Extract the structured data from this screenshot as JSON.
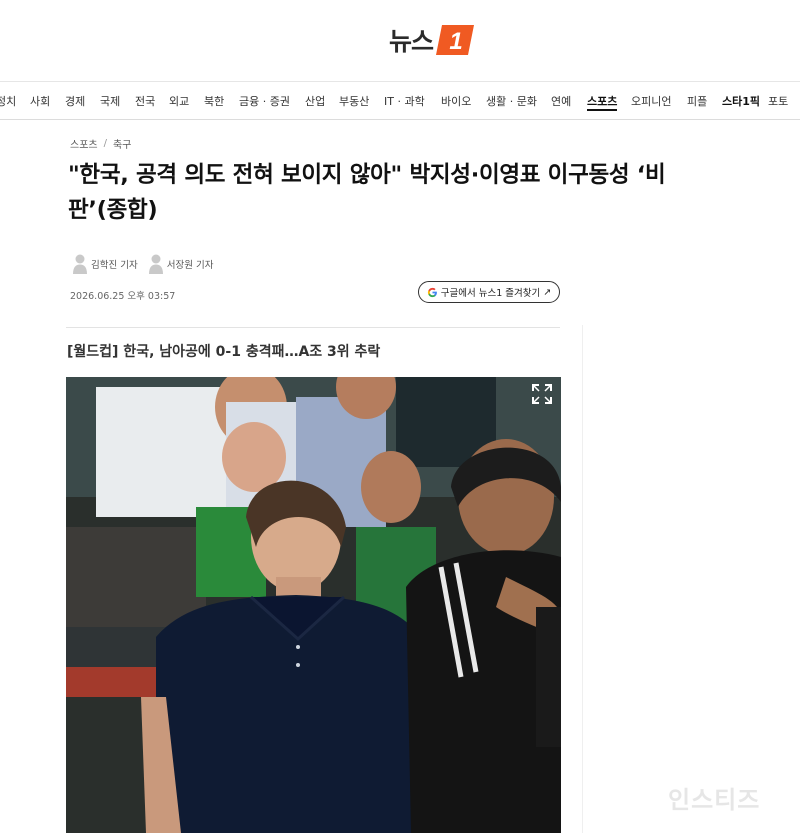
{
  "site": {
    "logo_text": "뉴스",
    "logo_mark_text": "1"
  },
  "nav": {
    "items": [
      {
        "label": "정치"
      },
      {
        "label": "사회"
      },
      {
        "label": "경제"
      },
      {
        "label": "국제"
      },
      {
        "label": "전국"
      },
      {
        "label": "외교"
      },
      {
        "label": "북한"
      },
      {
        "label": "금융 · 증권"
      },
      {
        "label": "산업"
      },
      {
        "label": "부동산"
      },
      {
        "label": "IT · 과학"
      },
      {
        "label": "바이오"
      },
      {
        "label": "생활 · 문화"
      },
      {
        "label": "연예"
      },
      {
        "label": "스포츠",
        "active": true
      },
      {
        "label": "오피니언"
      },
      {
        "label": "피플"
      },
      {
        "label": "스타1픽",
        "star": true
      },
      {
        "label": "포토"
      }
    ]
  },
  "breadcrumb": {
    "section": "스포츠",
    "separator": "/",
    "subsection": "축구"
  },
  "article": {
    "headline_line1": "\"한국, 공격 의도 전혀 보이지 않아\" 박지성·이영표 이구동성 ‘비",
    "headline_line2": "판’(종합)",
    "reporters": [
      "김학진 기자",
      "서장원 기자"
    ],
    "datetime": "2026.06.25 오후 03:57",
    "google_button_label": "구글에서 뉴스1 즐겨찾기",
    "google_button_arrow": "↗",
    "subheadline": "[월드컵] 한국, 남아공에 0-1 충격패…A조 3위 추락"
  },
  "watermark": "인스티즈",
  "colors": {
    "brand_orange": "#f05a22",
    "google_blue": "#4285F4",
    "google_red": "#EA4335",
    "google_yellow": "#FBBC05",
    "google_green": "#34A853"
  },
  "icons": {
    "logo_mark": "news1-logo-mark",
    "reporter": "person-icon",
    "google": "google-g-icon",
    "expand": "expand-icon"
  }
}
